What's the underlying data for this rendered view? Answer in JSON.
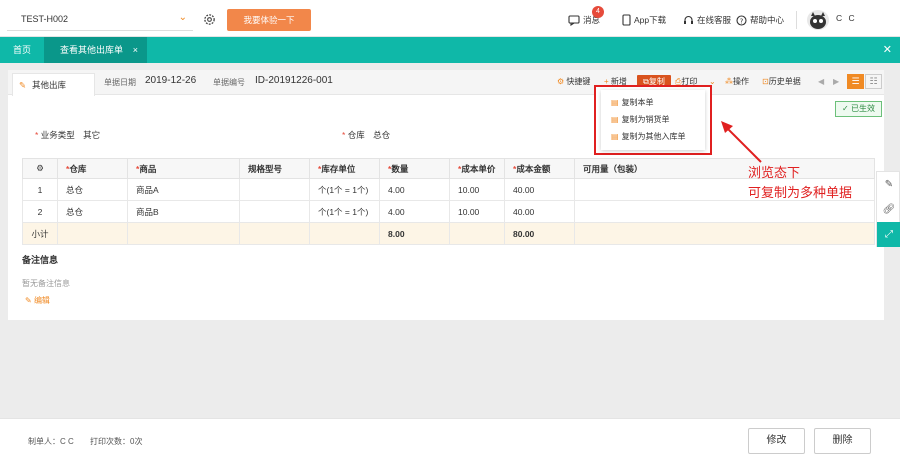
{
  "topbar": {
    "company": "TEST-H002",
    "try_label": "我要体验一下",
    "messages_label": "消息",
    "messages_badge": "4",
    "app_label": "App下载",
    "service_label": "在线客服",
    "help_label": "帮助中心",
    "user": "C C"
  },
  "tabs": {
    "home": "首页",
    "active": "查看其他出库单",
    "close": "×"
  },
  "doc": {
    "tab_label": "其他出库",
    "date_label": "单据日期",
    "date_value": "2019-12-26",
    "no_label": "单据编号",
    "no_value": "ID-20191226-001",
    "status": "已生效"
  },
  "actions": {
    "shortcut": "快捷键",
    "new": "新增",
    "copy": "复制",
    "print": "打印",
    "operate": "操作",
    "history": "历史单据"
  },
  "copy_menu": [
    "复制本单",
    "复制为销货单",
    "复制为其他入库单"
  ],
  "fields": {
    "biz_type_label": "业务类型",
    "biz_type_value": "其它",
    "warehouse_label": "仓库",
    "warehouse_value": "总仓"
  },
  "table": {
    "headers": [
      "仓库",
      "商品",
      "规格型号",
      "库存单位",
      "数量",
      "成本单价",
      "成本金额",
      "可用量（包装）"
    ],
    "rows": [
      {
        "no": "1",
        "warehouse": "总仓",
        "product": "商品A",
        "spec": "",
        "unit": "个(1个 = 1个)",
        "qty": "4.00",
        "price": "10.00",
        "amount": "40.00",
        "avail": ""
      },
      {
        "no": "2",
        "warehouse": "总仓",
        "product": "商品B",
        "spec": "",
        "unit": "个(1个 = 1个)",
        "qty": "4.00",
        "price": "10.00",
        "amount": "40.00",
        "avail": ""
      }
    ],
    "subtotal_label": "小计",
    "subtotal_qty": "8.00",
    "subtotal_amount": "80.00"
  },
  "remark": {
    "title": "备注信息",
    "empty": "暂无备注信息",
    "edit": "编辑"
  },
  "annotation": {
    "line1": "浏览态下",
    "line2": "可复制为多种单据"
  },
  "footer": {
    "maker": "制单人：C C",
    "print_count": "打印次数：0次",
    "modify": "修改",
    "delete": "删除"
  },
  "colors": {
    "teal": "#0fb8a8",
    "orange": "#f2874a",
    "red": "#e02020"
  }
}
